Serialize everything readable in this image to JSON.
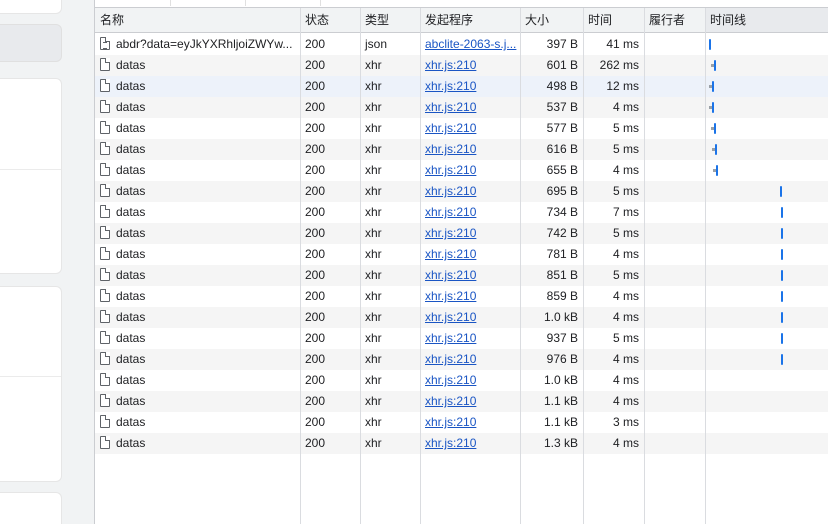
{
  "columns": [
    "名称",
    "状态",
    "类型",
    "发起程序",
    "大小",
    "时间",
    "履行者",
    "时间线"
  ],
  "rows": [
    {
      "name": "abdr?data=eyJkYXRhljoiZWYw...",
      "status": "200",
      "type": "json",
      "initiator": "abclite-2063-s.j...",
      "size": "397 B",
      "time": "41 ms",
      "icon": "data-file-icon",
      "waterfall": 0.03
    },
    {
      "name": "datas",
      "status": "200",
      "type": "xhr",
      "initiator": "xhr.js:210",
      "size": "601 B",
      "time": "262 ms",
      "icon": "file-icon",
      "waterfall": 0.07
    },
    {
      "name": "datas",
      "status": "200",
      "type": "xhr",
      "initiator": "xhr.js:210",
      "size": "498 B",
      "time": "12 ms",
      "icon": "file-icon",
      "waterfall": 0.06
    },
    {
      "name": "datas",
      "status": "200",
      "type": "xhr",
      "initiator": "xhr.js:210",
      "size": "537 B",
      "time": "4 ms",
      "icon": "file-icon",
      "waterfall": 0.06
    },
    {
      "name": "datas",
      "status": "200",
      "type": "xhr",
      "initiator": "xhr.js:210",
      "size": "577 B",
      "time": "5 ms",
      "icon": "file-icon",
      "waterfall": 0.07
    },
    {
      "name": "datas",
      "status": "200",
      "type": "xhr",
      "initiator": "xhr.js:210",
      "size": "616 B",
      "time": "5 ms",
      "icon": "file-icon",
      "waterfall": 0.08
    },
    {
      "name": "datas",
      "status": "200",
      "type": "xhr",
      "initiator": "xhr.js:210",
      "size": "655 B",
      "time": "4 ms",
      "icon": "file-icon",
      "waterfall": 0.09
    },
    {
      "name": "datas",
      "status": "200",
      "type": "xhr",
      "initiator": "xhr.js:210",
      "size": "695 B",
      "time": "5 ms",
      "icon": "file-icon",
      "waterfall": 0.61
    },
    {
      "name": "datas",
      "status": "200",
      "type": "xhr",
      "initiator": "xhr.js:210",
      "size": "734 B",
      "time": "7 ms",
      "icon": "file-icon",
      "waterfall": 0.62
    },
    {
      "name": "datas",
      "status": "200",
      "type": "xhr",
      "initiator": "xhr.js:210",
      "size": "742 B",
      "time": "5 ms",
      "icon": "file-icon",
      "waterfall": 0.62
    },
    {
      "name": "datas",
      "status": "200",
      "type": "xhr",
      "initiator": "xhr.js:210",
      "size": "781 B",
      "time": "4 ms",
      "icon": "file-icon",
      "waterfall": 0.62
    },
    {
      "name": "datas",
      "status": "200",
      "type": "xhr",
      "initiator": "xhr.js:210",
      "size": "851 B",
      "time": "5 ms",
      "icon": "file-icon",
      "waterfall": 0.62
    },
    {
      "name": "datas",
      "status": "200",
      "type": "xhr",
      "initiator": "xhr.js:210",
      "size": "859 B",
      "time": "4 ms",
      "icon": "file-icon",
      "waterfall": 0.62
    },
    {
      "name": "datas",
      "status": "200",
      "type": "xhr",
      "initiator": "xhr.js:210",
      "size": "1.0 kB",
      "time": "4 ms",
      "icon": "file-icon",
      "waterfall": 0.62
    },
    {
      "name": "datas",
      "status": "200",
      "type": "xhr",
      "initiator": "xhr.js:210",
      "size": "937 B",
      "time": "5 ms",
      "icon": "file-icon",
      "waterfall": 0.62
    },
    {
      "name": "datas",
      "status": "200",
      "type": "xhr",
      "initiator": "xhr.js:210",
      "size": "976 B",
      "time": "4 ms",
      "icon": "file-icon",
      "waterfall": 0.62
    },
    {
      "name": "datas",
      "status": "200",
      "type": "xhr",
      "initiator": "xhr.js:210",
      "size": "1.0 kB",
      "time": "4 ms",
      "icon": "file-icon",
      "waterfall": null
    },
    {
      "name": "datas",
      "status": "200",
      "type": "xhr",
      "initiator": "xhr.js:210",
      "size": "1.1 kB",
      "time": "4 ms",
      "icon": "file-icon",
      "waterfall": null
    },
    {
      "name": "datas",
      "status": "200",
      "type": "xhr",
      "initiator": "xhr.js:210",
      "size": "1.1 kB",
      "time": "3 ms",
      "icon": "file-icon",
      "waterfall": null
    },
    {
      "name": "datas",
      "status": "200",
      "type": "xhr",
      "initiator": "xhr.js:210",
      "size": "1.3 kB",
      "time": "4 ms",
      "icon": "file-icon",
      "waterfall": null
    }
  ],
  "colors": {
    "link": "#1a55c4",
    "waterfall": "#1a73e8",
    "header_bg": "#f1f3f4",
    "highlight_row": "#edf2fa"
  }
}
